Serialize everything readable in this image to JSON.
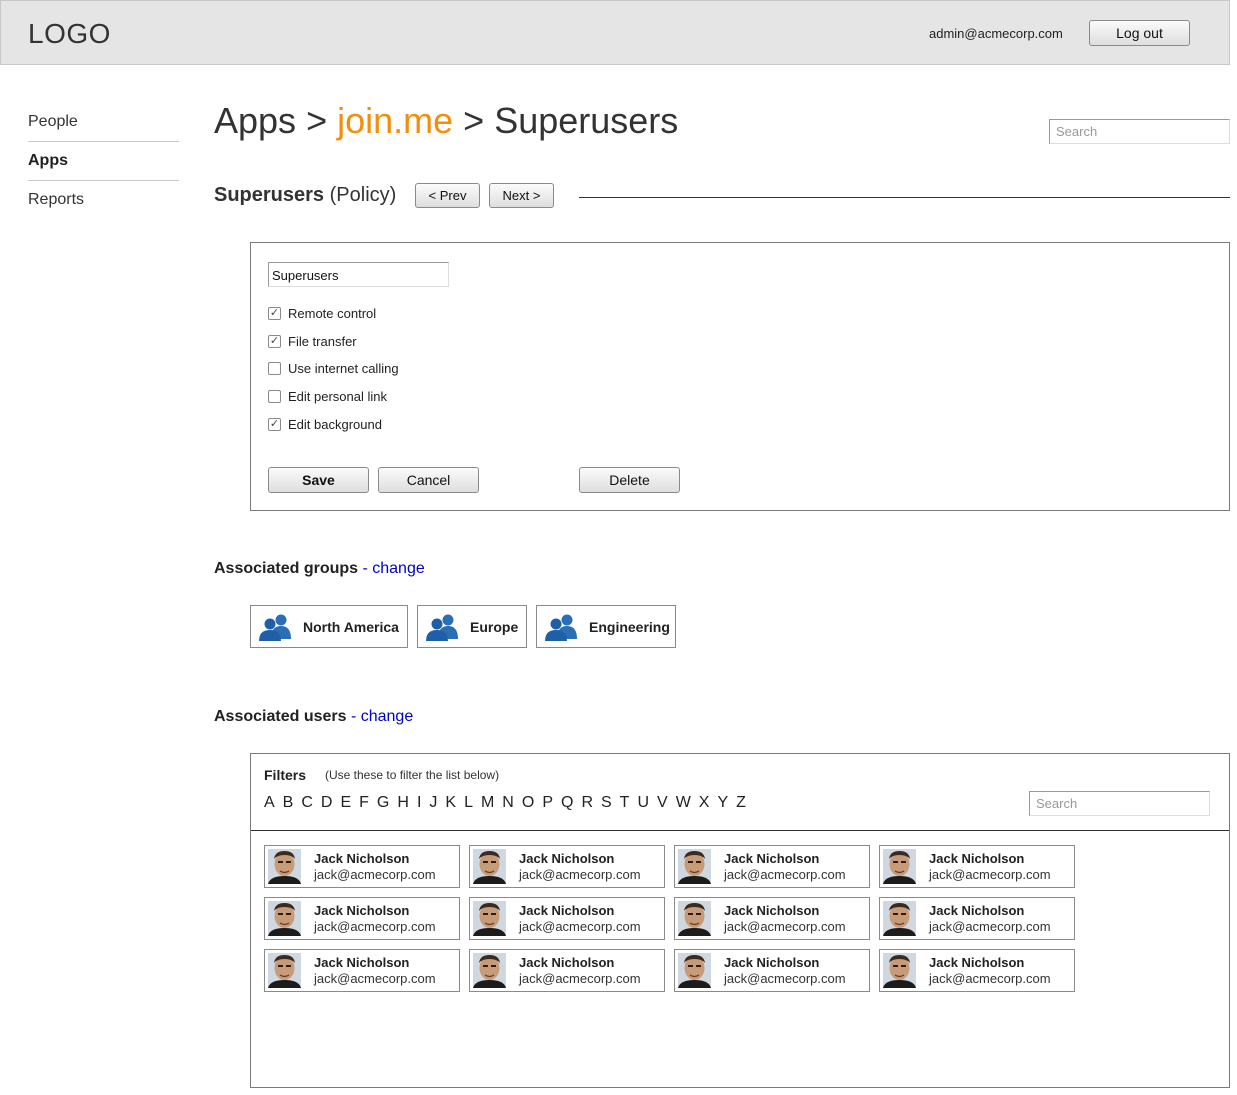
{
  "header": {
    "logo": "LOGO",
    "user_email": "admin@acmecorp.com",
    "logout_label": "Log out"
  },
  "nav": {
    "items": [
      {
        "label": "People",
        "active": false
      },
      {
        "label": "Apps",
        "active": true
      },
      {
        "label": "Reports",
        "active": false
      }
    ]
  },
  "breadcrumb": {
    "root": "Apps",
    "sep1": " > ",
    "app": "join.me",
    "sep2": " > ",
    "page": "Superusers",
    "app_color": "#f0900a"
  },
  "top_search": {
    "placeholder": "Search"
  },
  "policy_header": {
    "name": "Superusers",
    "type": "(Policy)",
    "prev_label": "< Prev",
    "next_label": "Next >"
  },
  "policy_form": {
    "name_value": "Superusers",
    "options": [
      {
        "label": "Remote control",
        "checked": true
      },
      {
        "label": "File transfer",
        "checked": true
      },
      {
        "label": "Use internet calling",
        "checked": false
      },
      {
        "label": "Edit personal link",
        "checked": false
      },
      {
        "label": "Edit background",
        "checked": true
      }
    ],
    "save_label": "Save",
    "cancel_label": "Cancel",
    "delete_label": "Delete"
  },
  "groups": {
    "title": "Associated groups",
    "dash": " - ",
    "change_label": "change",
    "items": [
      {
        "name": "North America",
        "icon": "group-icon"
      },
      {
        "name": "Europe",
        "icon": "group-icon"
      },
      {
        "name": "Engineering",
        "icon": "group-icon"
      }
    ]
  },
  "users": {
    "title": "Associated users",
    "dash": " - ",
    "change_label": "change",
    "filters_label": "Filters",
    "filters_hint": "(Use these to filter the list below)",
    "letters": [
      "A",
      "B",
      "C",
      "D",
      "E",
      "F",
      "G",
      "H",
      "I",
      "J",
      "K",
      "L",
      "M",
      "N",
      "O",
      "P",
      "Q",
      "R",
      "S",
      "T",
      "U",
      "V",
      "W",
      "X",
      "Y",
      "Z"
    ],
    "search_placeholder": "Search",
    "list": [
      {
        "name": "Jack Nicholson",
        "email": "jack@acmecorp.com"
      },
      {
        "name": "Jack Nicholson",
        "email": "jack@acmecorp.com"
      },
      {
        "name": "Jack Nicholson",
        "email": "jack@acmecorp.com"
      },
      {
        "name": "Jack Nicholson",
        "email": "jack@acmecorp.com"
      },
      {
        "name": "Jack Nicholson",
        "email": "jack@acmecorp.com"
      },
      {
        "name": "Jack Nicholson",
        "email": "jack@acmecorp.com"
      },
      {
        "name": "Jack Nicholson",
        "email": "jack@acmecorp.com"
      },
      {
        "name": "Jack Nicholson",
        "email": "jack@acmecorp.com"
      },
      {
        "name": "Jack Nicholson",
        "email": "jack@acmecorp.com"
      },
      {
        "name": "Jack Nicholson",
        "email": "jack@acmecorp.com"
      },
      {
        "name": "Jack Nicholson",
        "email": "jack@acmecorp.com"
      },
      {
        "name": "Jack Nicholson",
        "email": "jack@acmecorp.com"
      }
    ]
  }
}
